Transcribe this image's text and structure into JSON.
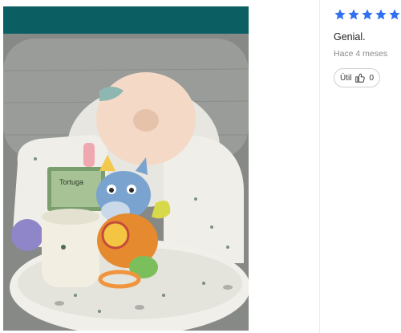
{
  "photo": {
    "alt": ""
  },
  "review": {
    "rating": 5,
    "star_color": "#2f6ff0",
    "text": "Genial.",
    "date": "Hace 4 meses",
    "helpful_label": "Útil",
    "helpful_count": "0",
    "helpful_icon": "thumbs-up-icon"
  },
  "photo_content": {
    "book_text": "Tortuga"
  }
}
